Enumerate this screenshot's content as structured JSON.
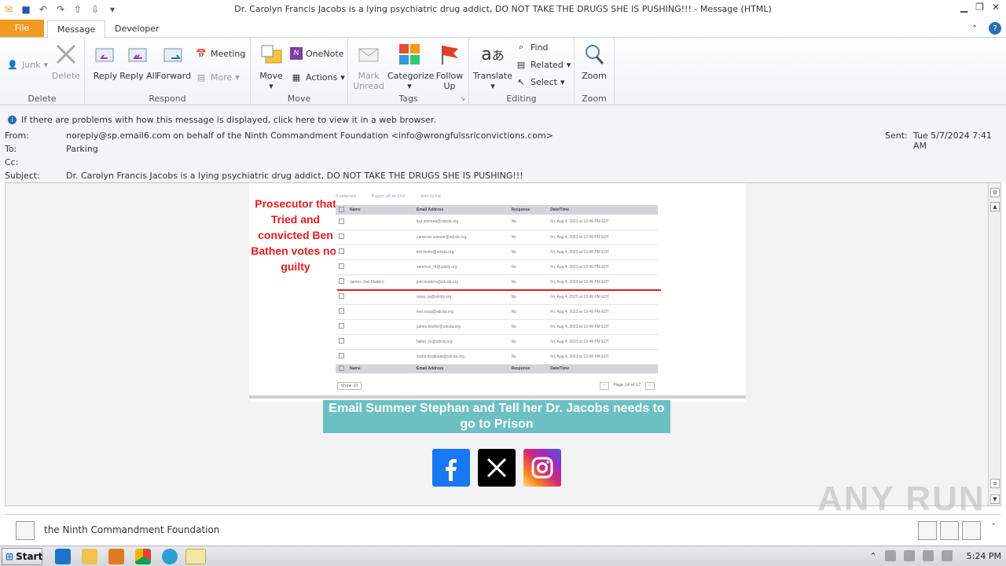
{
  "window": {
    "title": "Dr. Carolyn Francis Jacobs is a lying psychiatric drug addict, DO NOT TAKE THE DRUGS SHE IS PUSHING!!! - Message (HTML)"
  },
  "tabs": {
    "file": "File",
    "message": "Message",
    "developer": "Developer"
  },
  "ribbon": {
    "delete_group": {
      "junk": "Junk",
      "delete": "Delete",
      "label": "Delete"
    },
    "respond_group": {
      "reply": "Reply",
      "reply_all": "Reply All",
      "forward": "Forward",
      "meeting": "Meeting",
      "more": "More",
      "label": "Respond"
    },
    "move_group": {
      "move": "Move",
      "onenote": "OneNote",
      "actions": "Actions",
      "label": "Move"
    },
    "tags_group": {
      "mark_unread": "Mark Unread",
      "categorize": "Categorize",
      "follow_up": "Follow Up",
      "label": "Tags"
    },
    "editing_group": {
      "translate": "Translate",
      "find": "Find",
      "related": "Related",
      "select": "Select",
      "label": "Editing"
    },
    "zoom_group": {
      "zoom": "Zoom",
      "label": "Zoom"
    }
  },
  "header": {
    "notice": "If there are problems with how this message is displayed, click here to view it in a web browser.",
    "from_label": "From:",
    "from_value": "noreply@sp.email6.com on behalf of the Ninth Commandment Foundation <info@wrongfulssriconvictions.com>",
    "to_label": "To:",
    "to_value": "Parking",
    "cc_label": "Cc:",
    "subject_label": "Subject:",
    "subject_value": "Dr. Carolyn Francis Jacobs is a lying psychiatric drug addict, DO NOT TAKE THE DRUGS SHE IS PUSHING!!!",
    "sent_label": "Sent:",
    "sent_value": "Tue 5/7/2024 7:41 AM"
  },
  "body": {
    "prosecutor_text": "Prosecutor that Tried and convicted Ben Bathen votes not guilty",
    "embedded": {
      "toolbar": [
        "0 selected",
        "Export all as CSV",
        "Add to list"
      ],
      "columns": [
        "Name",
        "Email Address",
        "Response",
        "Date/Time"
      ],
      "rows": [
        {
          "name": "",
          "email": "lisa.weinreb@sdcda.org",
          "response": "No",
          "date": "Fri, Aug 4, 2023 at 10:49 PM EDT"
        },
        {
          "name": "",
          "email": "cameron.celeste@sdcda.org",
          "response": "No",
          "date": "Fri, Aug 4, 2023 at 10:49 PM EDT"
        },
        {
          "name": "",
          "email": "ted.fiorito@sdcda.org",
          "response": "No",
          "date": "Fri, Aug 4, 2023 at 10:49 PM EDT"
        },
        {
          "name": "",
          "email": "sanchez_th@sdcity.org",
          "response": "No",
          "date": "Fri, Aug 4, 2023 at 10:49 PM EDT"
        },
        {
          "name": "James Joel Madero",
          "email": "joel.madero@sdcda.org",
          "response": "No",
          "date": "Fri, Aug 4, 2023 at 10:49 PM EDT"
        },
        {
          "name": "",
          "email": "romo_ta@sdcity.org",
          "response": "No",
          "date": "Fri, Aug 4, 2023 at 10:49 PM EDT"
        },
        {
          "name": "",
          "email": "mel.sosa@sdcda.org",
          "response": "No",
          "date": "Fri, Aug 4, 2023 at 10:49 PM EDT"
        },
        {
          "name": "",
          "email": "james.hoefer@sdcda.org",
          "response": "No",
          "date": "Fri, Aug 4, 2023 at 10:49 PM EDT"
        },
        {
          "name": "",
          "email": "baker_br@sdcity.org",
          "response": "No",
          "date": "Fri, Aug 4, 2023 at 10:49 PM EDT"
        },
        {
          "name": "",
          "email": "maria.kingkade@sdcda.org",
          "response": "No",
          "date": "Fri, Aug 4, 2023 at 10:49 PM EDT"
        }
      ],
      "show": "Show 10",
      "page": "Page 14 of 17"
    },
    "cta": "Email Summer Stephan and Tell her Dr. Jacobs needs to go to Prison"
  },
  "people_pane": {
    "name": "the Ninth Commandment Foundation"
  },
  "taskbar": {
    "start": "Start",
    "clock": "5:24 PM"
  },
  "watermark": "ANY RUN"
}
